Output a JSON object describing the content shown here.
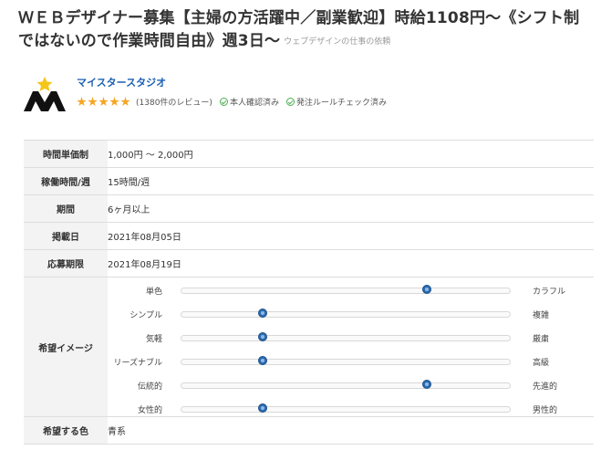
{
  "title": {
    "text": "ＷＥＢデザイナー募集【主婦の方活躍中／副業歓迎】時給1108円〜《シフト制ではないので作業時間自由》週3日〜",
    "category": "ウェブデザインの仕事の依頼"
  },
  "client": {
    "name": "マイスタースタジオ",
    "rating_stars": 5,
    "reviews": "(1380件のレビュー)",
    "badges": [
      "本人確認済み",
      "発注ルールチェック済み"
    ],
    "colors": {
      "name": "#1a5fb4",
      "star": "#f5a623",
      "check": "#4caf50"
    }
  },
  "details": {
    "rows": [
      {
        "label": "時間単価制",
        "value": "1,000円 ～ 2,000円"
      },
      {
        "label": "稼働時間/週",
        "value": "15時間/週"
      },
      {
        "label": "期間",
        "value": "6ヶ月以上"
      },
      {
        "label": "掲載日",
        "value": "2021年08月05日"
      },
      {
        "label": "応募期限",
        "value": "2021年08月19日"
      }
    ],
    "image_label": "希望イメージ",
    "sliders": [
      {
        "left": "単色",
        "right": "カラフル",
        "position": 0.75
      },
      {
        "left": "シンプル",
        "right": "複雑",
        "position": 0.25
      },
      {
        "left": "気軽",
        "right": "厳粛",
        "position": 0.25
      },
      {
        "left": "リーズナブル",
        "right": "高級",
        "position": 0.25
      },
      {
        "left": "伝統的",
        "right": "先進的",
        "position": 0.75
      },
      {
        "left": "女性的",
        "right": "男性的",
        "position": 0.25
      }
    ],
    "color_label": "希望する色",
    "color_value": "青系"
  }
}
